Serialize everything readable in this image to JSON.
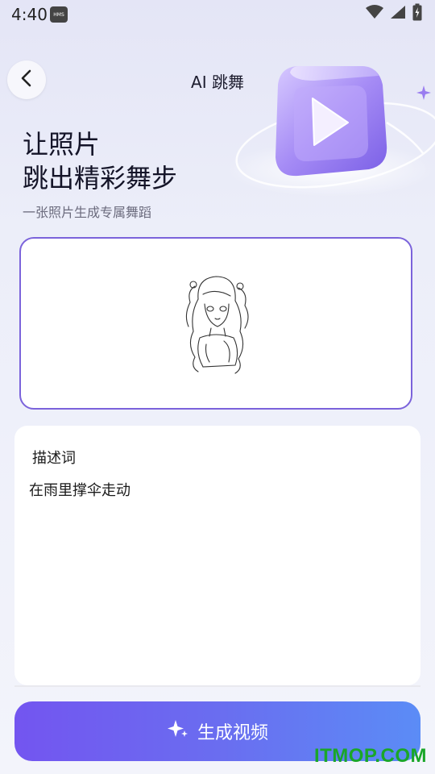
{
  "status_bar": {
    "time": "4:40",
    "badge": "HMS"
  },
  "header": {
    "title": "AI 跳舞"
  },
  "hero": {
    "headline_line1": "让照片",
    "headline_line2": "跳出精彩舞步",
    "subtitle": "一张照片生成专属舞蹈"
  },
  "prompt": {
    "label": "描述词",
    "value": "在雨里撑伞走动"
  },
  "actions": {
    "generate_label": "生成视频"
  },
  "watermark": "ITMOP.COM",
  "colors": {
    "accent": "#7b63db",
    "button_start": "#7355f0",
    "button_end": "#5b8cf6",
    "watermark": "#1aa629"
  },
  "icons": [
    "wifi-icon",
    "signal-icon",
    "battery-icon",
    "back-arrow-icon",
    "sparkle-icon",
    "play-icon"
  ]
}
